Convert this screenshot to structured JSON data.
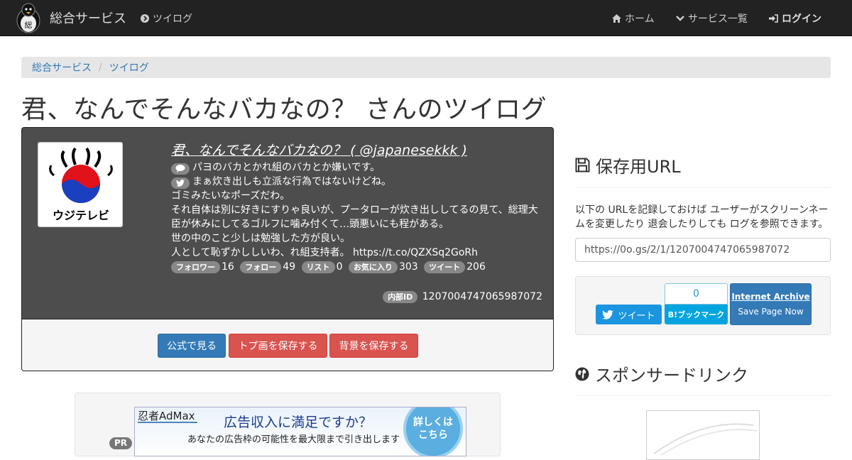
{
  "navbar": {
    "brand": "総合サービス",
    "section": "ツイログ",
    "home": "ホーム",
    "services": "サービス一覧",
    "login": "ログイン"
  },
  "breadcrumb": [
    "総合サービス",
    "ツイログ"
  ],
  "page_title": "君、なんでそんなバカなの？ さんのツイログ",
  "profile": {
    "name": "君、なんでそんなバカなの？ ( @japanesekkk )",
    "line1": "パヨのバカとかれ組のバカとか嫌いです。",
    "line2": "まぁ炊き出しも立派な行為ではないけどね。",
    "bio_lines": [
      "ゴミみたいなポーズだわ。",
      "それ自体は別に好きにすりゃ良いが、プータローが炊き出ししてるの見て、総理大臣が休みにしてるゴルフに噛み付くて…頭悪いにも程がある。",
      "世の中のこと少しは勉強した方が良い。",
      "人として恥ずかししいわ、れ組支持者。 https://t.co/QZXSq2GoRh"
    ],
    "stats": [
      {
        "label": "フォロワー",
        "value": "16"
      },
      {
        "label": "フォロー",
        "value": "49"
      },
      {
        "label": "リスト",
        "value": "0"
      },
      {
        "label": "お気に入り",
        "value": "303"
      },
      {
        "label": "ツイート",
        "value": "206"
      }
    ],
    "internal_label": "内部ID",
    "internal_id": "1207004747065987072",
    "avatar_text": "ウジテレビ"
  },
  "actions": {
    "official": "公式で見る",
    "save_top": "トプ画を保存する",
    "save_bg": "背景を保存する"
  },
  "ad": {
    "pr": "PR",
    "brand": "忍者AdMax",
    "headline": "広告収入に満足ですか？",
    "sub": "あなたの広告枠の可能性を最大限まで引き出します",
    "badge1": "詳しくは",
    "badge2": "こちら"
  },
  "save": {
    "heading": "保存用URL",
    "description": "以下の URLを記録しておけば ユーザーがスクリーンネームを変更したり 退会したりしても ログを参照できます。",
    "url": "https://0o.gs/2/1/1207004747065987072"
  },
  "share": {
    "tweet": "ツイート",
    "hatena_count": "0",
    "hatena": "B!ブックマーク",
    "ia_title": "Internet Archive",
    "ia_sub": "Save Page Now"
  },
  "sponsor": {
    "heading": "スポンサードリンク"
  },
  "colors": {
    "navbar": "#222222",
    "primary": "#337ab7",
    "danger": "#d9534f",
    "profile_bg": "#4d4d4d"
  }
}
